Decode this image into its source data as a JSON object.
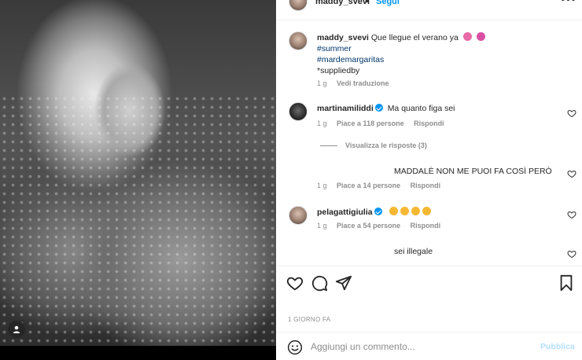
{
  "post": {
    "username": "maddy_svevi",
    "separator": "•",
    "follow_label": "Segui",
    "more_label": "•••"
  },
  "caption": {
    "username": "maddy_svevi",
    "text": "Que llegue el verano ya",
    "tags": [
      "#summer",
      "#mardemargaritas"
    ],
    "credit": "*suppliedby",
    "time": "1 g",
    "translate_label": "Vedi traduzione",
    "emoji_colors": [
      "#e86aa8",
      "#d94fa3"
    ]
  },
  "comments": [
    {
      "username": "martinamiliddi",
      "verified": true,
      "text": "Ma quanto figa sei",
      "time": "1 g",
      "likes": "Piace a 118 persone",
      "reply": "Rispondi"
    },
    {
      "username": "",
      "verified": false,
      "text": "MADDALÈ NON ME PUOI FA COSÌ PERÒ",
      "time": "1 g",
      "likes": "Piace a 14 persone",
      "reply": "Rispondi"
    },
    {
      "username": "pelagattigiulia",
      "verified": true,
      "text": "",
      "time": "1 g",
      "likes": "Piace a 54 persone",
      "reply": "Rispondi",
      "emoji_colors": [
        "#f5b833",
        "#f5b833",
        "#f5b833",
        "#f5b833"
      ]
    },
    {
      "username": "",
      "verified": false,
      "text": "sei illegale"
    }
  ],
  "replies_label": "Visualizza le risposte (3)",
  "date_label": "1 GIORNO FA",
  "composer": {
    "placeholder": "Aggiungi un commento...",
    "publish_label": "Pubblica"
  },
  "colors": {
    "accent": "#0095f6",
    "publish_disabled": "#b2dffc",
    "secondary_text": "#8e8e8e"
  },
  "icons": [
    "heart-icon",
    "comment-icon",
    "share-icon",
    "bookmark-icon",
    "smiley-icon",
    "user-tag-icon",
    "more-icon",
    "verified-icon"
  ]
}
